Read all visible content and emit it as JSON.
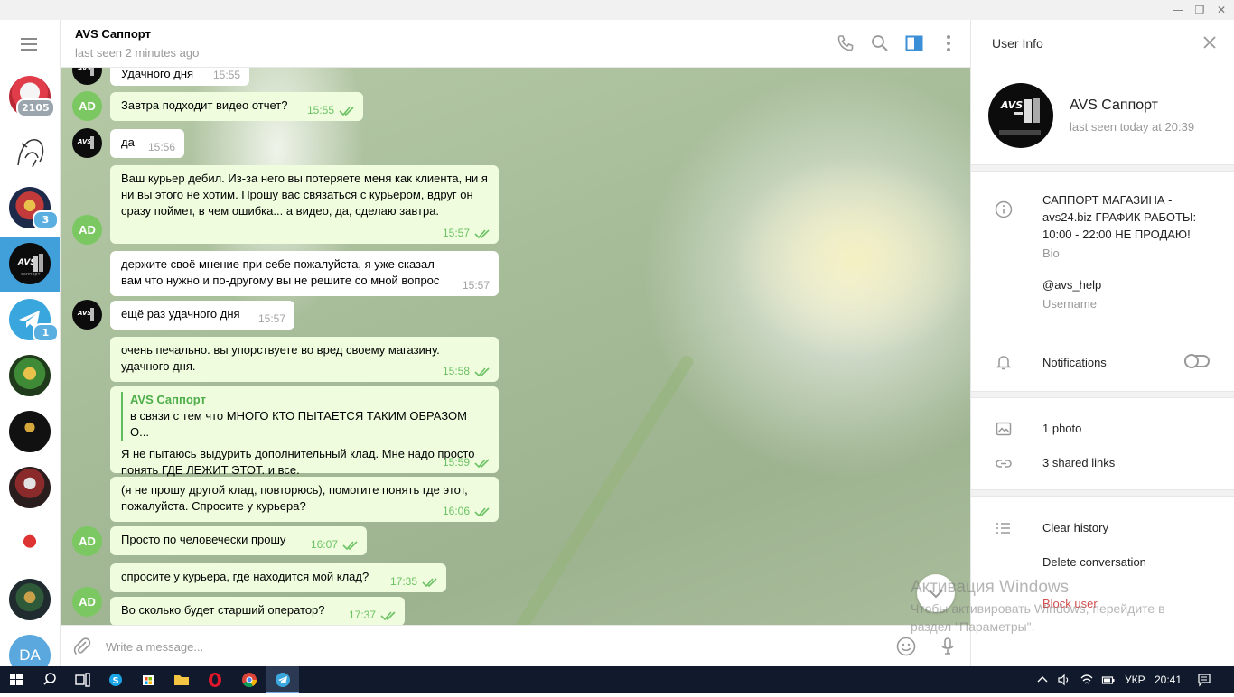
{
  "window": {
    "minimize": "—",
    "restore": "❐",
    "close": "✕"
  },
  "rail": {
    "menu_icon": "hamburger-icon",
    "chats": [
      {
        "name": "chat-1",
        "badge": "2105",
        "badge_style": "gray",
        "color": "#d64855"
      },
      {
        "name": "chat-2",
        "badge": "",
        "color": "#ffffff"
      },
      {
        "name": "chat-3",
        "badge": "3",
        "badge_style": "blue",
        "color": "#c23a3a"
      },
      {
        "name": "chat-avs",
        "badge": "",
        "color": "#0c0c0c",
        "active": true
      },
      {
        "name": "chat-telegram",
        "badge": "1",
        "badge_style": "blue",
        "color": "#3aa6de"
      },
      {
        "name": "chat-6",
        "badge": "",
        "color": "#2f6b2a"
      },
      {
        "name": "chat-7",
        "badge": "",
        "color": "#111111"
      },
      {
        "name": "chat-8",
        "badge": "",
        "color": "#3b2a2a"
      },
      {
        "name": "chat-9",
        "badge": "",
        "color": "#ffffff"
      },
      {
        "name": "chat-10",
        "badge": "",
        "color": "#1f2b2f"
      }
    ],
    "profile_initials": "DA"
  },
  "header": {
    "title": "AVS Саппорт",
    "status": "last seen 2 minutes ago",
    "icons": [
      "phone-icon",
      "search-icon",
      "sidebar-toggle-icon",
      "more-icon"
    ]
  },
  "messages": [
    {
      "dir": "in",
      "text": "Удачного дня",
      "time": "15:55"
    },
    {
      "dir": "out",
      "text": "Завтра подходит видео отчет?",
      "time": "15:55"
    },
    {
      "dir": "in",
      "text": "да",
      "time": "15:56"
    },
    {
      "dir": "out",
      "text": "Ваш курьер дебил. Из-за него вы потеряете меня как клиента, ни я ни вы этого не хотим. Прошу вас связаться с курьером, вдруг он сразу поймет, в чем ошибка... а видео, да, сделаю завтра.",
      "time": "15:57"
    },
    {
      "dir": "in",
      "text": "держите своё мнение при себе пожалуйста, я уже сказал вам что нужно и по-другому вы не решите со мной вопрос",
      "time": "15:57"
    },
    {
      "dir": "in",
      "text": "ещё раз удачного дня",
      "time": "15:57"
    },
    {
      "dir": "out",
      "text": "очень печально. вы упорствуете во вред своему магазину. удачного дня.",
      "time": "15:58"
    },
    {
      "dir": "out",
      "reply_name": "AVS Саппорт",
      "reply_text": "в связи с тем что МНОГО КТО ПЫТАЕТСЯ ТАКИМ ОБРАЗОМ О...",
      "text": "Я не пытаюсь выдурить дополнительный клад. Мне надо просто понять ГДЕ ЛЕЖИТ ЭТОТ. и все.",
      "time": "15:59"
    },
    {
      "dir": "out",
      "text": "(я не прошу другой клад, повторюсь), помогите понять где этот, пожалуйста. Спросите у курьера?",
      "time": "16:06"
    },
    {
      "dir": "out",
      "text": "Просто по человечески прошу",
      "time": "16:07"
    },
    {
      "dir": "out",
      "text": "спросите у курьера, где находится мой клад?",
      "time": "17:35"
    },
    {
      "dir": "out",
      "text": "Во сколько будет старший оператор?",
      "time": "17:37"
    }
  ],
  "avatars": {
    "me": "AD"
  },
  "composer": {
    "placeholder": "Write a message..."
  },
  "info": {
    "title": "User Info",
    "name": "AVS Саппорт",
    "seen": "last seen today at 20:39",
    "avatar_text": "AVS",
    "bio": "САППОРТ МАГАЗИНА - avs24.biz ГРАФИК РАБОТЫ: 10:00 - 22:00 НЕ ПРОДАЮ!",
    "bio_label": "Bio",
    "username": "@avs_help",
    "username_label": "Username",
    "notifications": "Notifications",
    "notifications_on": false,
    "photos": "1 photo",
    "links": "3 shared links",
    "clear_history": "Clear history",
    "delete_conversation": "Delete conversation",
    "block_user": "Block user"
  },
  "watermark": {
    "line1": "Активация Windows",
    "line2": "Чтобы активировать Windows, перейдите в",
    "line3": "раздел \"Параметры\"."
  },
  "taskbar": {
    "lang": "УКР",
    "time": "20:41",
    "apps": [
      "start-icon",
      "search-icon",
      "task-view-icon",
      "skype-icon",
      "store-icon",
      "explorer-icon",
      "opera-icon",
      "chrome-icon",
      "telegram-icon"
    ]
  }
}
